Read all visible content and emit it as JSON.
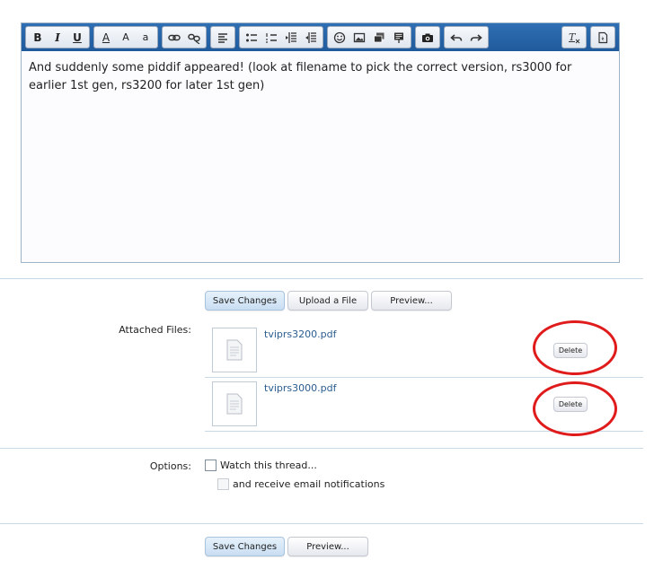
{
  "toolbar": {
    "groups": [
      [
        "bold-icon",
        "italic-icon",
        "underline-icon"
      ],
      [
        "text-color-icon",
        "font-size-icon",
        "font-family-icon"
      ],
      [
        "link-icon",
        "unlink-icon"
      ],
      [
        "align-icon"
      ],
      [
        "bulleted-list-icon",
        "numbered-list-icon",
        "outdent-icon",
        "indent-icon"
      ],
      [
        "smiley-icon",
        "image-icon",
        "media-icon",
        "code-icon"
      ],
      [
        "camera-icon"
      ],
      [
        "undo-icon",
        "redo-icon"
      ],
      [
        "remove-format-icon"
      ],
      [
        "bbcode-toggle-icon"
      ]
    ],
    "labels": {
      "bold": "B",
      "italic": "I",
      "underline": "U",
      "text_color": "A",
      "font_size": "A",
      "font_family": "a"
    }
  },
  "editor": {
    "text": "And suddenly some piddif appeared!  (look at filename to pick the correct version, rs3000 for earlier 1st gen, rs3200 for later 1st gen)"
  },
  "actions_top": {
    "save_label": "Save Changes",
    "upload_label": "Upload a File",
    "preview_label": "Preview..."
  },
  "attachments": {
    "label": "Attached Files:",
    "files": [
      {
        "name": "tviprs3200.pdf",
        "delete_label": "Delete"
      },
      {
        "name": "tviprs3000.pdf",
        "delete_label": "Delete"
      }
    ]
  },
  "options": {
    "label": "Options:",
    "watch_label": "Watch this thread...",
    "email_label": "and receive email notifications"
  },
  "actions_bottom": {
    "save_label": "Save Changes",
    "preview_label": "Preview..."
  },
  "colors": {
    "toolbar": "#2f6fb3",
    "annotation_ring": "#e01b1b",
    "link": "#2a5d8f"
  }
}
